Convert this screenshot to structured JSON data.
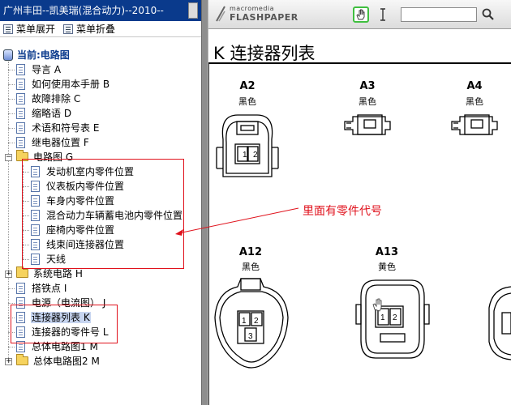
{
  "window": {
    "title": "广州丰田--凯美瑞(混合动力)--2010--"
  },
  "toolbar": {
    "expand_label": "菜单展开",
    "collapse_label": "菜单折叠"
  },
  "tree": {
    "root_label": "当前:电路图",
    "items": [
      {
        "label": "导言  A"
      },
      {
        "label": "如何使用本手册  B"
      },
      {
        "label": "故障排除  C"
      },
      {
        "label": "缩略语  D"
      },
      {
        "label": "术语和符号表  E"
      },
      {
        "label": "继电器位置  F"
      },
      {
        "label": "电路图  G"
      },
      {
        "label": "发动机室内零件位置"
      },
      {
        "label": "仪表板内零件位置"
      },
      {
        "label": "车身内零件位置"
      },
      {
        "label": "混合动力车辆蓄电池内零件位置"
      },
      {
        "label": "座椅内零件位置"
      },
      {
        "label": "线束间连接器位置"
      },
      {
        "label": "天线"
      },
      {
        "label": "系统电路  H"
      },
      {
        "label": "搭铁点  I"
      },
      {
        "label": "电源（电流图）  J"
      },
      {
        "label": "连接器列表  K"
      },
      {
        "label": "连接器的零件号  L"
      },
      {
        "label": "总体电路图1  M"
      },
      {
        "label": "总体电路图2  M"
      }
    ]
  },
  "viewer": {
    "brand_top": "macromedia",
    "brand_bottom": "FLASHPAPER",
    "find_value": "",
    "page_title": "K 连接器列表",
    "connectors": [
      {
        "id": "A2",
        "color": "黑色"
      },
      {
        "id": "A3",
        "color": "黑色"
      },
      {
        "id": "A4",
        "color": "黑色"
      },
      {
        "id": "A12",
        "color": "黑色"
      },
      {
        "id": "A13",
        "color": "黄色"
      }
    ]
  },
  "annotation": {
    "text": "里面有零件代号",
    "color": "#e0121c"
  },
  "colors": {
    "title_bar": "#0a3a8c",
    "highlight_box": "#e0121c",
    "selected_item": "#c7d5f0"
  }
}
